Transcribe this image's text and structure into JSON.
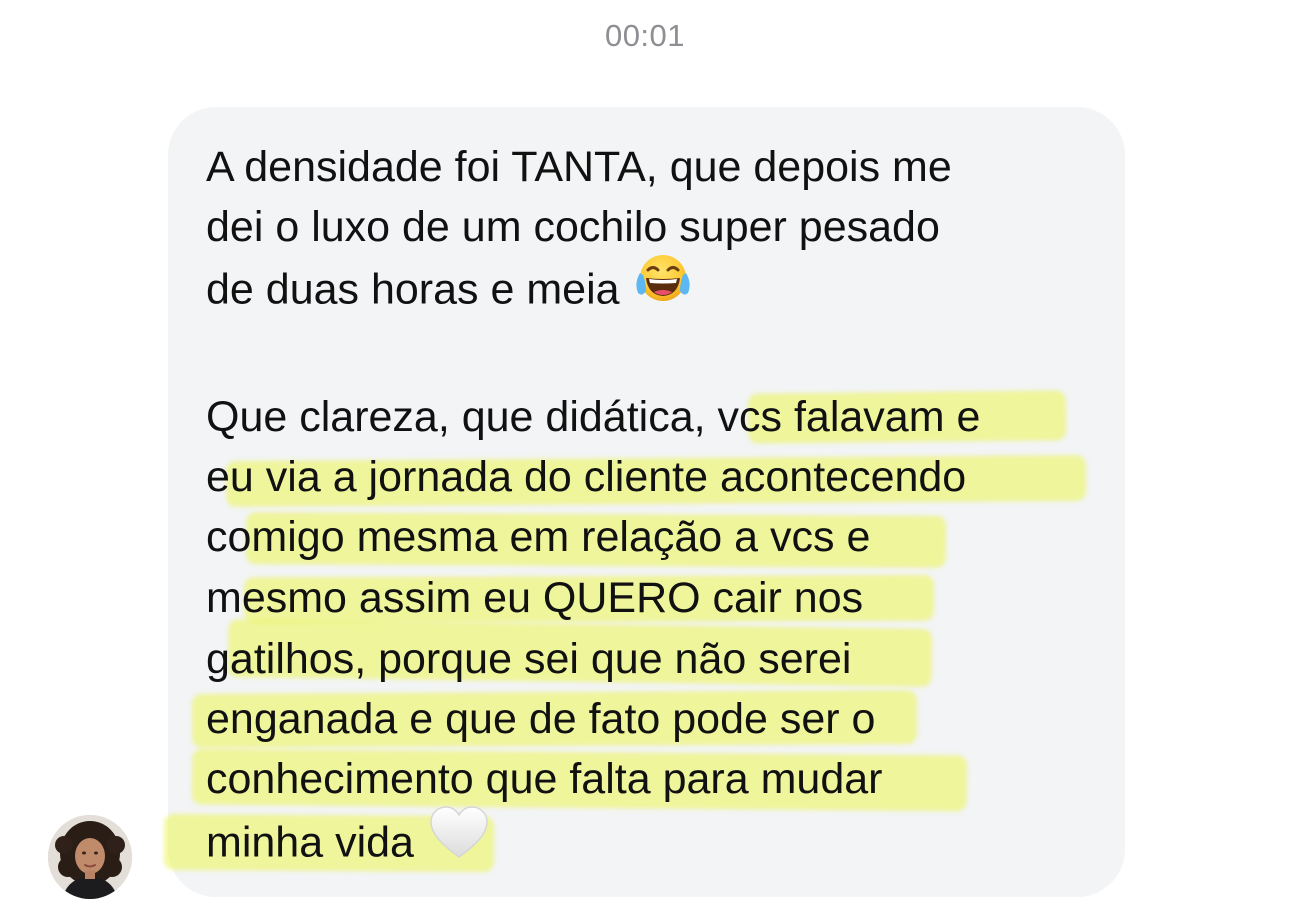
{
  "header": {
    "timestamp": "00:01"
  },
  "message": {
    "paragraph1": {
      "lines": [
        "A densidade foi TANTA, que depois me",
        "dei o luxo de um cochilo super pesado",
        "de duas horas e meia"
      ],
      "trailing_emoji": "face-with-tears-of-joy-icon"
    },
    "paragraph2": {
      "lines": [
        "Que clareza, que didática, vcs falavam e",
        "eu via a jornada do cliente acontecendo",
        "comigo mesma em relação a vcs e",
        "mesmo assim eu QUERO cair nos",
        "gatilhos, porque sei que não serei",
        "enganada e que de fato pode ser o",
        "conhecimento que falta para mudar",
        "minha vida"
      ],
      "trailing_emoji": "white-heart-icon"
    }
  },
  "sender": {
    "avatar_icon": "avatar-photo"
  },
  "colors": {
    "bubble": "#f2f4f5",
    "highlight": "#eef564",
    "text": "#111111",
    "timestamp": "#8e8e93"
  }
}
